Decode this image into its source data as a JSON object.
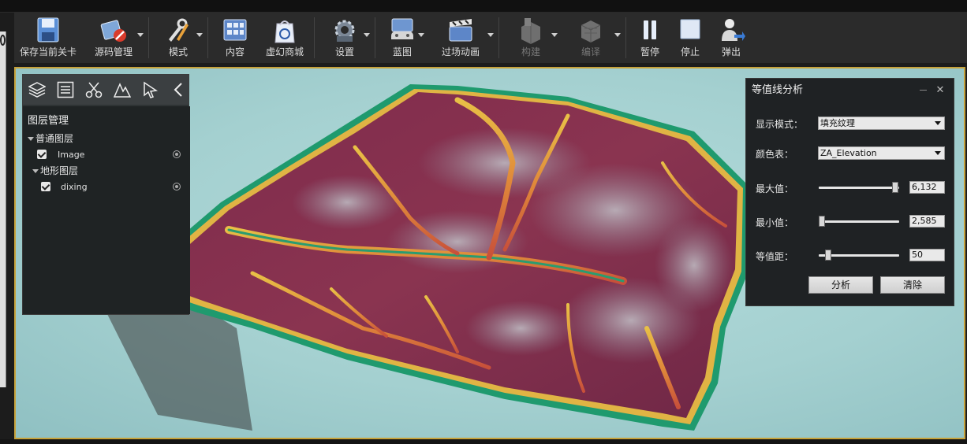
{
  "toolbar": {
    "buttons": [
      {
        "label": "保存当前关卡",
        "icon": "save-icon"
      },
      {
        "label": "源码管理",
        "icon": "source-control-icon"
      },
      {
        "label": "模式",
        "icon": "modes-icon"
      },
      {
        "label": "内容",
        "icon": "content-icon"
      },
      {
        "label": "虚幻商城",
        "icon": "marketplace-icon"
      },
      {
        "label": "设置",
        "icon": "settings-icon"
      },
      {
        "label": "蓝图",
        "icon": "blueprint-icon"
      },
      {
        "label": "过场动画",
        "icon": "cinematics-icon"
      },
      {
        "label": "构建",
        "icon": "build-icon"
      },
      {
        "label": "编译",
        "icon": "compile-icon"
      },
      {
        "label": "暂停",
        "icon": "pause-icon"
      },
      {
        "label": "停止",
        "icon": "stop-icon"
      },
      {
        "label": "弹出",
        "icon": "eject-icon"
      }
    ]
  },
  "layer_panel": {
    "title": "图层管理",
    "groups": [
      {
        "label": "普通图层",
        "items": [
          {
            "label": "Image",
            "checked": true
          }
        ]
      },
      {
        "label": "地形图层",
        "items": [
          {
            "label": "dixing",
            "checked": true
          }
        ]
      }
    ]
  },
  "contour_panel": {
    "title": "等值线分析",
    "display_mode": {
      "label": "显示模式：",
      "value": "填充纹理"
    },
    "color_table": {
      "label": "颜色表：",
      "value": "ZA_Elevation"
    },
    "max": {
      "label": "最大值：",
      "value": "6,132",
      "fraction": 0.99
    },
    "min": {
      "label": "最小值：",
      "value": "2,585",
      "fraction": 0.0
    },
    "interval": {
      "label": "等值距：",
      "value": "50",
      "fraction": 0.08
    },
    "analyze_label": "分析",
    "clear_label": "清除"
  },
  "colors": {
    "accent_border": "#c7a23a",
    "terrain_low": "#1f9a6e",
    "terrain_mid": "#e8b23a",
    "terrain_high": "#7e2a4c",
    "terrain_peak": "#a99aa6"
  }
}
